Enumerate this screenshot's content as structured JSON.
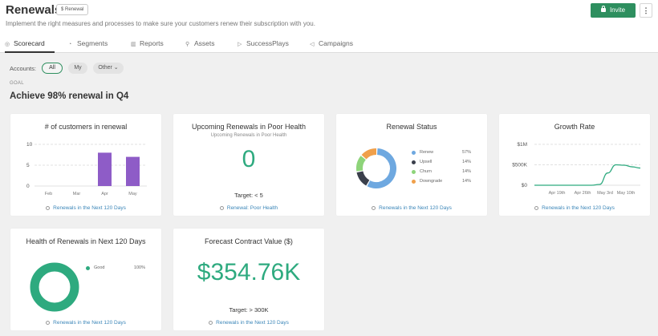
{
  "header": {
    "title": "Renewals",
    "badge": "$ Renewal",
    "subtitle": "Implement the right measures and processes to make sure your customers renew their subscription with you.",
    "invite_label": "Invite",
    "more_label": "⋮"
  },
  "tabs": [
    {
      "label": "Scorecard",
      "icon": "scorecard-icon",
      "active": true
    },
    {
      "label": "Segments",
      "icon": "segments-icon"
    },
    {
      "label": "Reports",
      "icon": "reports-icon"
    },
    {
      "label": "Assets",
      "icon": "assets-icon"
    },
    {
      "label": "SuccessPlays",
      "icon": "play-icon"
    },
    {
      "label": "Campaigns",
      "icon": "megaphone-icon"
    }
  ],
  "filters": {
    "label": "Accounts:",
    "options": [
      "All",
      "My",
      "Other ⌄"
    ],
    "selected": "All"
  },
  "goal": {
    "label": "GOAL",
    "text": "Achieve 98% renewal in Q4"
  },
  "cards": {
    "customers_in_renewal": {
      "title": "# of customers in renewal",
      "link": "Renewals in the Next 120 Days"
    },
    "poor_health": {
      "title": "Upcoming Renewals in Poor Health",
      "subtitle": "Upcoming Renewals in Poor Health",
      "value": "0",
      "target": "Target: < 5",
      "link": "Renewal: Poor Health"
    },
    "renewal_status": {
      "title": "Renewal Status",
      "link": "Renewals in the Next 120 Days"
    },
    "growth_rate": {
      "title": "Growth Rate",
      "link": "Renewals in the Next 120 Days"
    },
    "health_next_120": {
      "title": "Health of Renewals in Next 120 Days",
      "link": "Renewals in the Next 120 Days"
    },
    "forecast": {
      "title": "Forecast Contract Value ($)",
      "value": "$354.76K",
      "target": "Target: > 300K",
      "link": "Renewals in the Next 120 Days"
    }
  },
  "colors": {
    "accent_green": "#2e8f5f",
    "number_green": "#2eaa7f",
    "bar_purple": "#8e5cc7",
    "link_blue": "#3b86b8"
  },
  "chart_data": [
    {
      "type": "bar",
      "categories": [
        "Feb",
        "Mar",
        "Apr",
        "May"
      ],
      "values": [
        0,
        0,
        8,
        7
      ],
      "ylim": [
        0,
        10
      ],
      "yticks": [
        "10",
        "5",
        "0"
      ],
      "grid": true
    },
    {
      "type": "pie",
      "labels": [
        "Renew",
        "Upsell",
        "Churn",
        "Downgrade"
      ],
      "values": [
        57,
        14,
        14,
        14
      ],
      "value_labels": [
        "57%",
        "14%",
        "14%",
        "14%"
      ],
      "colors": [
        "#6ea8e0",
        "#3a3f4b",
        "#8ed47a",
        "#f0a04b"
      ]
    },
    {
      "type": "line",
      "x": [
        "Apr 19th",
        "Apr 26th",
        "May 3rd",
        "May 10th"
      ],
      "yticks": [
        "$1M",
        "$500K",
        "$0"
      ],
      "ylim": [
        0,
        1000000
      ],
      "points": [
        0,
        0,
        0,
        0,
        0,
        0,
        0,
        0,
        20000,
        300000,
        500000,
        490000,
        450000,
        420000
      ],
      "color": "#2eaa7f"
    },
    {
      "type": "pie",
      "labels": [
        "Good"
      ],
      "values": [
        100
      ],
      "value_labels": [
        "100%"
      ],
      "colors": [
        "#2eaa7f"
      ]
    }
  ]
}
